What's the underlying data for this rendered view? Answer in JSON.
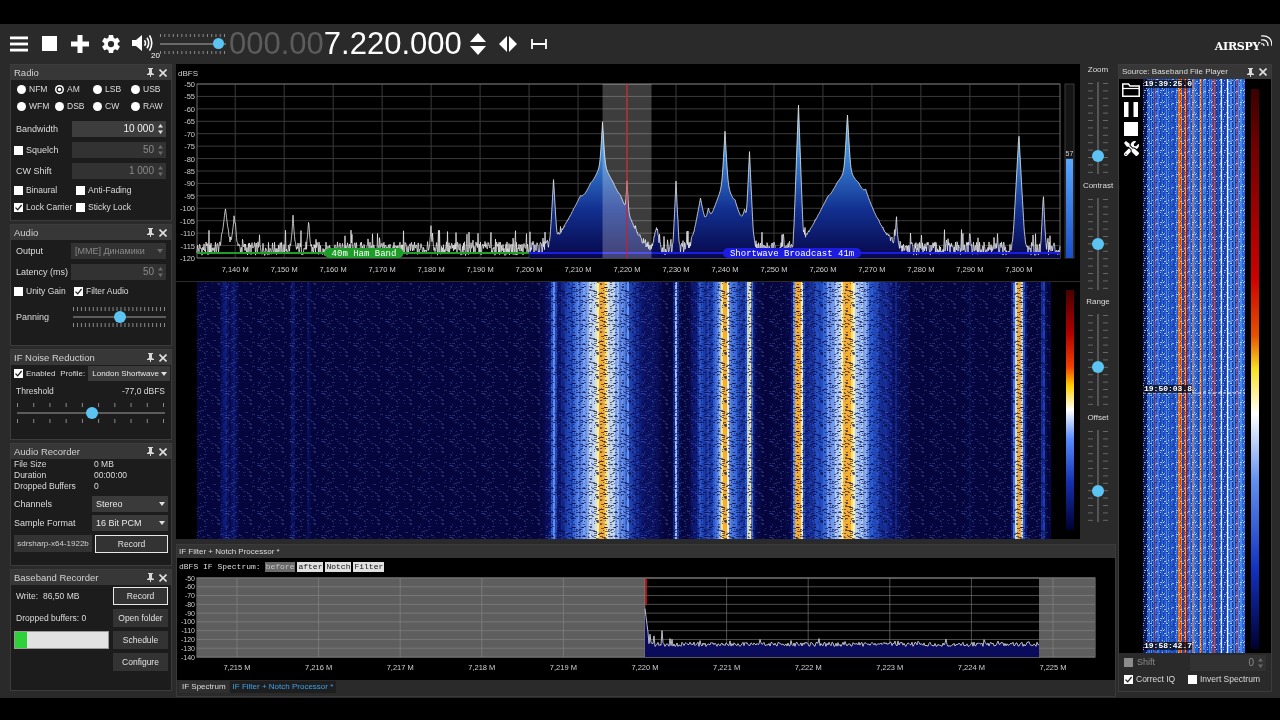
{
  "toolbar": {
    "volume": {
      "value": "20",
      "level": 0.88
    },
    "frequency": {
      "leading": "000.00",
      "value": "7.220.000"
    },
    "logo": "AIRSPY"
  },
  "radio": {
    "title": "Radio",
    "modes": [
      {
        "label": "NFM",
        "selected": false
      },
      {
        "label": "AM",
        "selected": true
      },
      {
        "label": "LSB",
        "selected": false
      },
      {
        "label": "USB",
        "selected": false
      },
      {
        "label": "WFM",
        "selected": false
      },
      {
        "label": "DSB",
        "selected": false
      },
      {
        "label": "CW",
        "selected": false
      },
      {
        "label": "RAW",
        "selected": false
      }
    ],
    "fields": [
      {
        "kind": "spin",
        "label": "Bandwidth",
        "value": "10 000",
        "disabled": false
      },
      {
        "kind": "check",
        "label": "Squelch",
        "checked": false,
        "value": "50",
        "disabled": true
      },
      {
        "kind": "spin",
        "label": "CW Shift",
        "value": "1 000",
        "disabled": true
      }
    ],
    "options": [
      {
        "label": "Binaural",
        "checked": false
      },
      {
        "label": "Anti-Fading",
        "checked": false
      },
      {
        "label": "Lock Carrier",
        "checked": true
      },
      {
        "label": "Sticky Lock",
        "checked": false
      }
    ]
  },
  "audio": {
    "title": "Audio",
    "fields": [
      {
        "kind": "select",
        "label": "Output",
        "value": "[MME] Динамики",
        "disabled": true
      },
      {
        "kind": "spin",
        "label": "Latency (ms)",
        "value": "50",
        "disabled": true
      }
    ],
    "options": [
      {
        "label": "Unity Gain",
        "checked": false
      },
      {
        "label": "Filter Audio",
        "checked": true
      }
    ],
    "panning": {
      "label": "Panning",
      "level": 0.5
    }
  },
  "if_noise_reduction": {
    "title": "IF Noise Reduction",
    "enabled": {
      "label": "Enabled",
      "checked": true
    },
    "profile_label": "Profile:",
    "profile": "London Shortwave",
    "threshold": {
      "label": "Threshold",
      "reading": "-77,0 dBFS",
      "level": 0.51
    }
  },
  "audio_recorder": {
    "title": "Audio Recorder",
    "stats": [
      {
        "label": "File Size",
        "value": "0 MB"
      },
      {
        "label": "Duration",
        "value": "00:00:00"
      },
      {
        "label": "Dropped Buffers",
        "value": "0"
      }
    ],
    "fields": [
      {
        "kind": "select",
        "label": "Channels",
        "value": "Stereo",
        "disabled": false
      },
      {
        "kind": "select",
        "label": "Sample Format",
        "value": "16 Bit PCM",
        "disabled": false
      }
    ],
    "file_name": "sdrsharp-x64-1922b",
    "button": {
      "label": "Record",
      "kind": "primary"
    }
  },
  "baseband_recorder": {
    "title": "Baseband Recorder",
    "write": {
      "label": "Write:",
      "value": "86,50 MB"
    },
    "dropped": "Dropped buffers: 0",
    "progress": {
      "level": 0.13
    },
    "buttons": [
      {
        "label": "Record",
        "kind": "primary"
      },
      {
        "label": "Open folder",
        "kind": "normal"
      },
      {
        "label": "Schedule",
        "kind": "normal"
      },
      {
        "label": "Configure",
        "kind": "normal"
      }
    ]
  },
  "spectrum": {
    "unit": "dBFS",
    "y_labels": [
      "-50",
      "-55",
      "-60",
      "-65",
      "-70",
      "-75",
      "-80",
      "-85",
      "-90",
      "-95",
      "-100",
      "-105",
      "-110",
      "-115",
      "-120"
    ],
    "x_labels": [
      "7,140 M",
      "7,150 M",
      "7,160 M",
      "7,170 M",
      "7,180 M",
      "7,190 M",
      "7,200 M",
      "7,210 M",
      "7,220 M",
      "7,230 M",
      "7,240 M",
      "7,250 M",
      "7,260 M",
      "7,270 M",
      "7,280 M",
      "7,290 M",
      "7,300 M"
    ],
    "bands": [
      {
        "label": "40m Ham Band",
        "color": "#1e9e28"
      },
      {
        "label": "Shortwave Broadcast 41m",
        "color": "#1c1ce0"
      }
    ],
    "signal_meter": {
      "reading": "57",
      "level": 0.57
    }
  },
  "display_controls": [
    {
      "label": "Zoom",
      "level": 0.2
    },
    {
      "label": "Contrast",
      "level": 0.5
    },
    {
      "label": "Range",
      "level": 0.42
    },
    {
      "label": "Offset",
      "level": 0.34
    }
  ],
  "if_filter": {
    "title": "IF Filter + Notch Processor *",
    "caption": "dBFS IF Spectrum:",
    "toggles": [
      {
        "label": "before",
        "on": false
      },
      {
        "label": "after",
        "on": true
      },
      {
        "label": "Notch",
        "on": true
      },
      {
        "label": "Filter",
        "on": true
      }
    ],
    "y_labels": [
      "-50",
      "-60",
      "-70",
      "-80",
      "-90",
      "-100",
      "-110",
      "-120",
      "-130",
      "-140"
    ],
    "x_labels": [
      "7,215 M",
      "7,216 M",
      "7,217 M",
      "7,218 M",
      "7,219 M",
      "7,220 M",
      "7,221 M",
      "7,222 M",
      "7,223 M",
      "7,224 M",
      "7,225 M"
    ],
    "tabs": [
      {
        "label": "IF Spectrum",
        "selected": false
      },
      {
        "label": "IF Filter + Notch Processor *",
        "selected": true
      }
    ]
  },
  "source": {
    "title": "Source: Baseband File Player",
    "timestamps": [
      "19:39:25.0",
      "19:50:03.8",
      "19:58:42.7"
    ],
    "shift": {
      "label": "Shift",
      "checked": false,
      "disabled": true,
      "value": "0"
    },
    "options": [
      {
        "label": "Correct IQ",
        "checked": true
      },
      {
        "label": "Invert Spectrum",
        "checked": false
      }
    ]
  }
}
